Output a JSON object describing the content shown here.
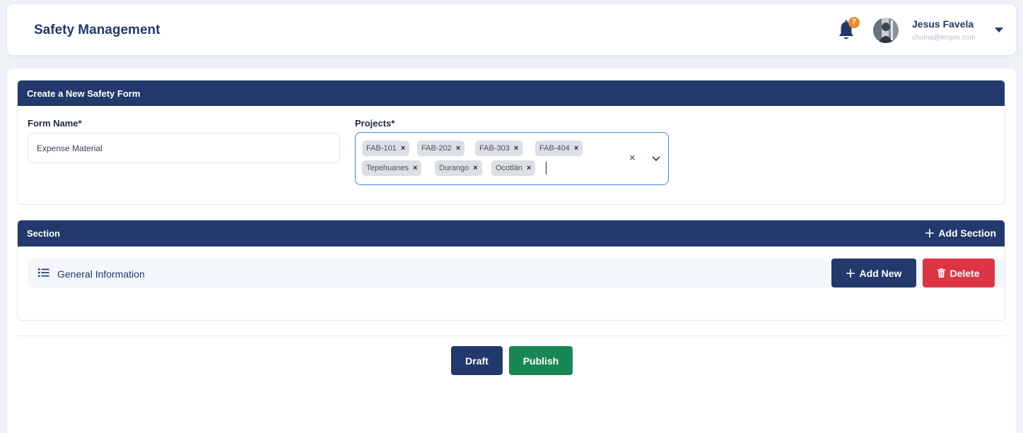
{
  "header": {
    "app_title": "Safety Management",
    "notification_count": "7",
    "user": {
      "name": "Jesus Favela",
      "email": "chuma@teopm.com"
    }
  },
  "form_card": {
    "title": "Create a New Safety Form",
    "form_name_label": "Form Name*",
    "form_name_value": "Expense Material",
    "projects_label": "Projects*",
    "projects_selected": [
      "FAB-101",
      "FAB-202",
      "FAB-303",
      "FAB-404",
      "Tepehuanes",
      "Durango",
      "Ocotlán"
    ],
    "chip_remove_glyph": "×",
    "clear_glyph": "×"
  },
  "section_card": {
    "title": "Section",
    "add_section_label": "Add Section",
    "sections": [
      {
        "name": "General Information",
        "add_new_label": "Add New",
        "delete_label": "Delete"
      }
    ]
  },
  "footer": {
    "draft_label": "Draft",
    "publish_label": "Publish"
  },
  "colors": {
    "navy": "#23396b",
    "danger": "#dc3545",
    "success": "#198754",
    "badge": "#f0892e",
    "focus": "#3d8be0"
  }
}
